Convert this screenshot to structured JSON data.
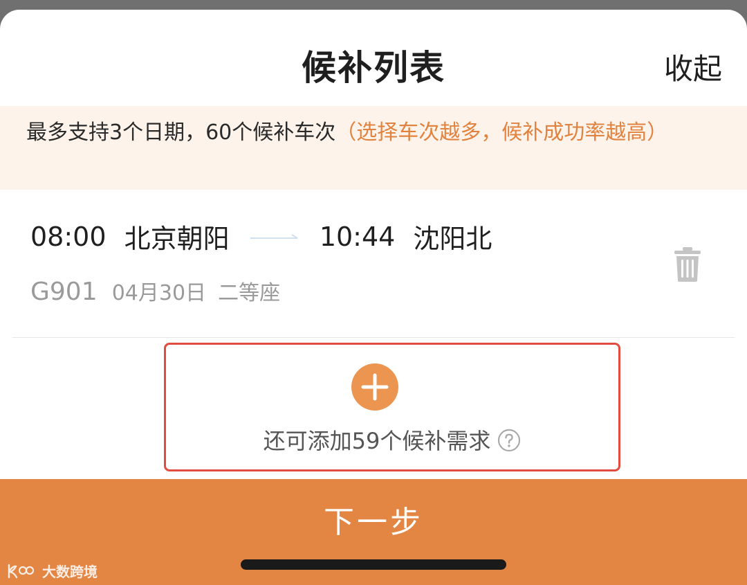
{
  "sheet": {
    "title": "候补列表",
    "collapse_label": "收起"
  },
  "notice": {
    "main_text": "最多支持3个日期，60个候补车次",
    "hint_text": "（选择车次越多，候补成功率越高）"
  },
  "trip": {
    "depart_time": "08:00",
    "depart_station": "北京朝阳",
    "arrive_time": "10:44",
    "arrive_station": "沈阳北",
    "train_no": "G901",
    "date": "04月30日",
    "seat_class": "二等座",
    "delete_icon": "trash-icon",
    "arrow_icon": "arrow-right-icon"
  },
  "add": {
    "icon": "plus-circle-icon",
    "text": "还可添加59个候补需求",
    "help_icon": "question-circle-icon"
  },
  "footer": {
    "next_label": "下一步",
    "watermark": "大数跨境"
  },
  "colors": {
    "accent": "#e38543",
    "notice_bg": "#fdf3ea",
    "hint_text": "#e1833f",
    "highlight_border": "#e24b3f",
    "muted_text": "#9a9a9a"
  }
}
